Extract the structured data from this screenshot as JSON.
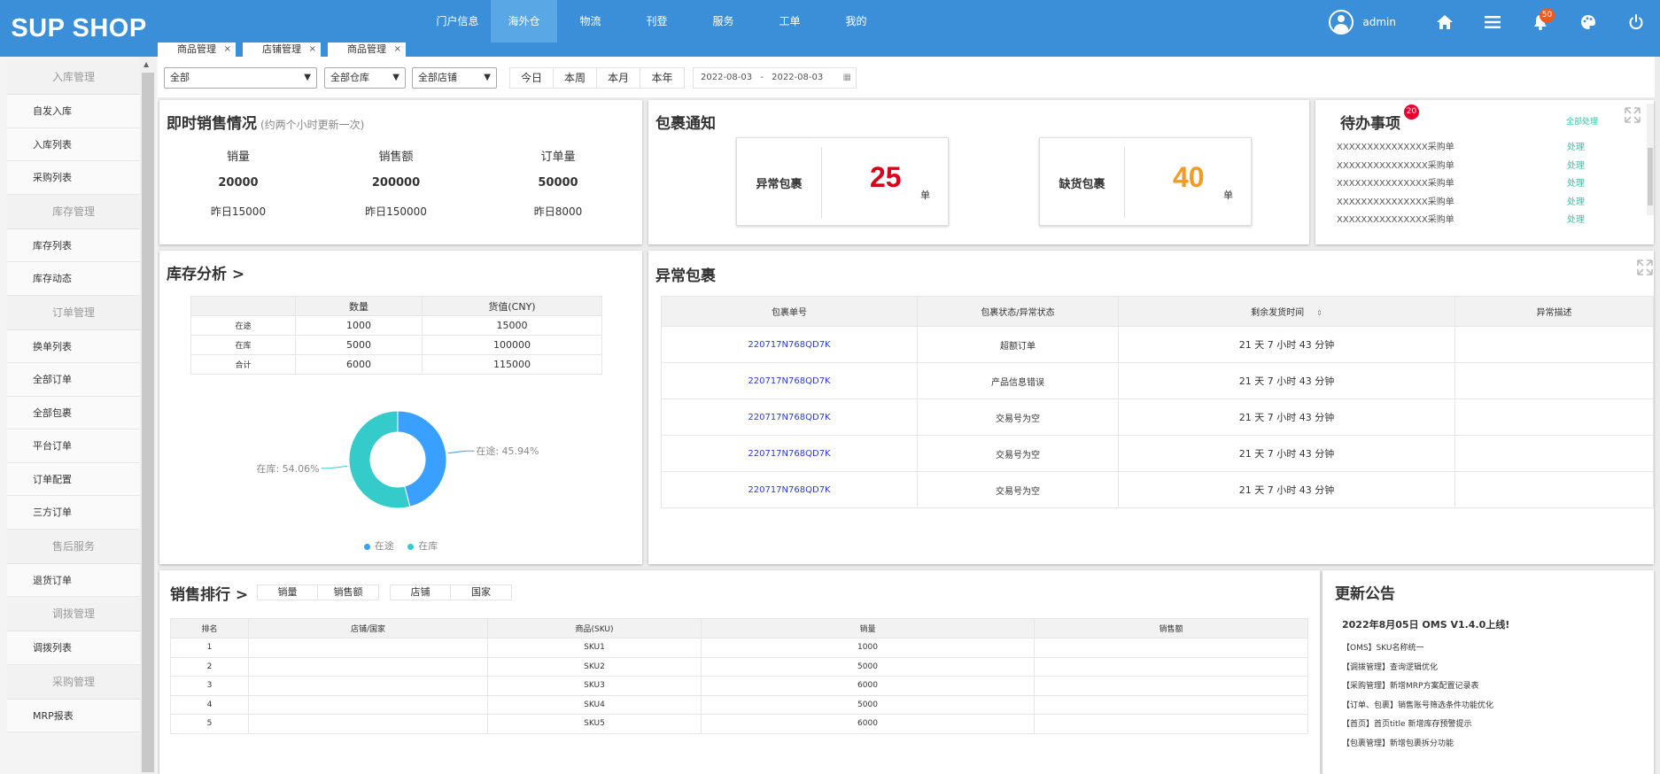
{
  "header": {
    "logo": "SUP SHOP",
    "nav": [
      "门户信息",
      "海外仓",
      "物流",
      "刊登",
      "服务",
      "工单",
      "我的"
    ],
    "active_nav": "海外仓",
    "username": "admin",
    "notification_count": "50",
    "icons": [
      "user-icon",
      "home-icon",
      "menu-icon",
      "bell-icon",
      "palette-icon",
      "power-icon"
    ]
  },
  "tabs": [
    {
      "label": "商品管理",
      "close": "×"
    },
    {
      "label": "店铺管理",
      "close": "×"
    },
    {
      "label": "商品管理",
      "close": "×"
    }
  ],
  "sidebar": {
    "items": [
      {
        "type": "group",
        "label": "入库管理"
      },
      {
        "type": "item",
        "label": "自发入库"
      },
      {
        "type": "item",
        "label": "入库列表"
      },
      {
        "type": "item",
        "label": "采购列表"
      },
      {
        "type": "group",
        "label": "库存管理"
      },
      {
        "type": "item",
        "label": "库存列表"
      },
      {
        "type": "item",
        "label": "库存动态"
      },
      {
        "type": "group",
        "label": "订单管理"
      },
      {
        "type": "item",
        "label": "换单列表"
      },
      {
        "type": "item",
        "label": "全部订单"
      },
      {
        "type": "item",
        "label": "全部包裹"
      },
      {
        "type": "item",
        "label": "平台订单"
      },
      {
        "type": "item",
        "label": "订单配置"
      },
      {
        "type": "item",
        "label": "三方订单"
      },
      {
        "type": "group",
        "label": "售后服务"
      },
      {
        "type": "item",
        "label": "退货订单"
      },
      {
        "type": "group",
        "label": "调拨管理"
      },
      {
        "type": "item",
        "label": "调拨列表"
      },
      {
        "type": "group",
        "label": "采购管理"
      },
      {
        "type": "item",
        "label": "MRP报表"
      }
    ]
  },
  "filters": {
    "selects": [
      "全部",
      "全部仓库",
      "全部店铺"
    ],
    "periods": [
      "今日",
      "本周",
      "本月",
      "本年"
    ],
    "date_start": "2022-08-03",
    "date_sep": "-",
    "date_end": "2022-08-03"
  },
  "sales_now": {
    "title": "即时销售情况",
    "subtitle": "(约两个小时更新一次)",
    "metrics": [
      {
        "label": "销量",
        "value": "20000",
        "yesterday": "昨日15000"
      },
      {
        "label": "销售额",
        "value": "200000",
        "yesterday": "昨日150000"
      },
      {
        "label": "订单量",
        "value": "50000",
        "yesterday": "昨日8000"
      }
    ]
  },
  "package_notice": {
    "title": "包裹通知",
    "boxes": [
      {
        "label": "异常包裹",
        "value": "25",
        "unit": "单",
        "color": "#d9001b"
      },
      {
        "label": "缺货包裹",
        "value": "40",
        "unit": "单",
        "color": "#f59a23"
      }
    ]
  },
  "todo": {
    "title": "待办事项",
    "badge": "20",
    "all_action": "全部处理",
    "items": [
      {
        "text": "XXXXXXXXXXXXXXX采购单",
        "action": "处理"
      },
      {
        "text": "XXXXXXXXXXXXXXX采购单",
        "action": "处理"
      },
      {
        "text": "XXXXXXXXXXXXXXX采购单",
        "action": "处理"
      },
      {
        "text": "XXXXXXXXXXXXXXX采购单",
        "action": "处理"
      },
      {
        "text": "XXXXXXXXXXXXXXX采购单",
        "action": "处理"
      }
    ]
  },
  "inventory": {
    "title": "库存分析 >",
    "columns": [
      "",
      "数量",
      "货值(CNY)"
    ],
    "rows": [
      [
        "在途",
        "1000",
        "15000"
      ],
      [
        "在库",
        "5000",
        "100000"
      ],
      [
        "合计",
        "6000",
        "115000"
      ]
    ]
  },
  "chart_data": {
    "type": "pie",
    "series": [
      {
        "name": "在途",
        "value": 45.94,
        "label": "在途: 45.94%",
        "color": "#3aa0ff"
      },
      {
        "name": "在库",
        "value": 54.06,
        "label": "在库: 54.06%",
        "color": "#36cbcb"
      }
    ],
    "legend_position": "bottom"
  },
  "abnormal": {
    "title": "异常包裹",
    "columns": [
      "包裹单号",
      "包裹状态/异常状态",
      "剩余发货时间",
      "异常描述"
    ],
    "sort_icon": "sort-icon",
    "rows": [
      [
        "220717N768QD7K",
        "超额订单",
        "21 天 7 小时 43 分钟",
        ""
      ],
      [
        "220717N768QD7K",
        "产品信息错误",
        "21 天 7 小时 43 分钟",
        ""
      ],
      [
        "220717N768QD7K",
        "交易号为空",
        "21 天 7 小时 43 分钟",
        ""
      ],
      [
        "220717N768QD7K",
        "交易号为空",
        "21 天 7 小时 43 分钟",
        ""
      ],
      [
        "220717N768QD7K",
        "交易号为空",
        "21 天 7 小时 43 分钟",
        ""
      ]
    ]
  },
  "ranking": {
    "title": "销售排行 >",
    "metric_tabs": [
      "销量",
      "销售额"
    ],
    "dim_tabs": [
      "店铺",
      "国家"
    ],
    "columns": [
      "排名",
      "店铺/国家",
      "商品(SKU)",
      "销量",
      "销售额"
    ],
    "rows": [
      [
        "1",
        "",
        "SKU1",
        "1000",
        ""
      ],
      [
        "2",
        "",
        "SKU2",
        "5000",
        ""
      ],
      [
        "3",
        "",
        "SKU3",
        "6000",
        ""
      ],
      [
        "4",
        "",
        "SKU4",
        "5000",
        ""
      ],
      [
        "5",
        "",
        "SKU5",
        "6000",
        ""
      ]
    ]
  },
  "announcements": {
    "title": "更新公告",
    "headline": "2022年8月05日 OMS V1.4.0上线!",
    "items": [
      "【OMS】SKU名称统一",
      "【调拨管理】查询逻辑优化",
      "【采购管理】新增MRP方案配置记录表",
      "【订单、包裹】销售账号筛选条件功能优化",
      "【首页】首页title 新增库存预警提示",
      "【包裹管理】新增包裹拆分功能"
    ]
  }
}
